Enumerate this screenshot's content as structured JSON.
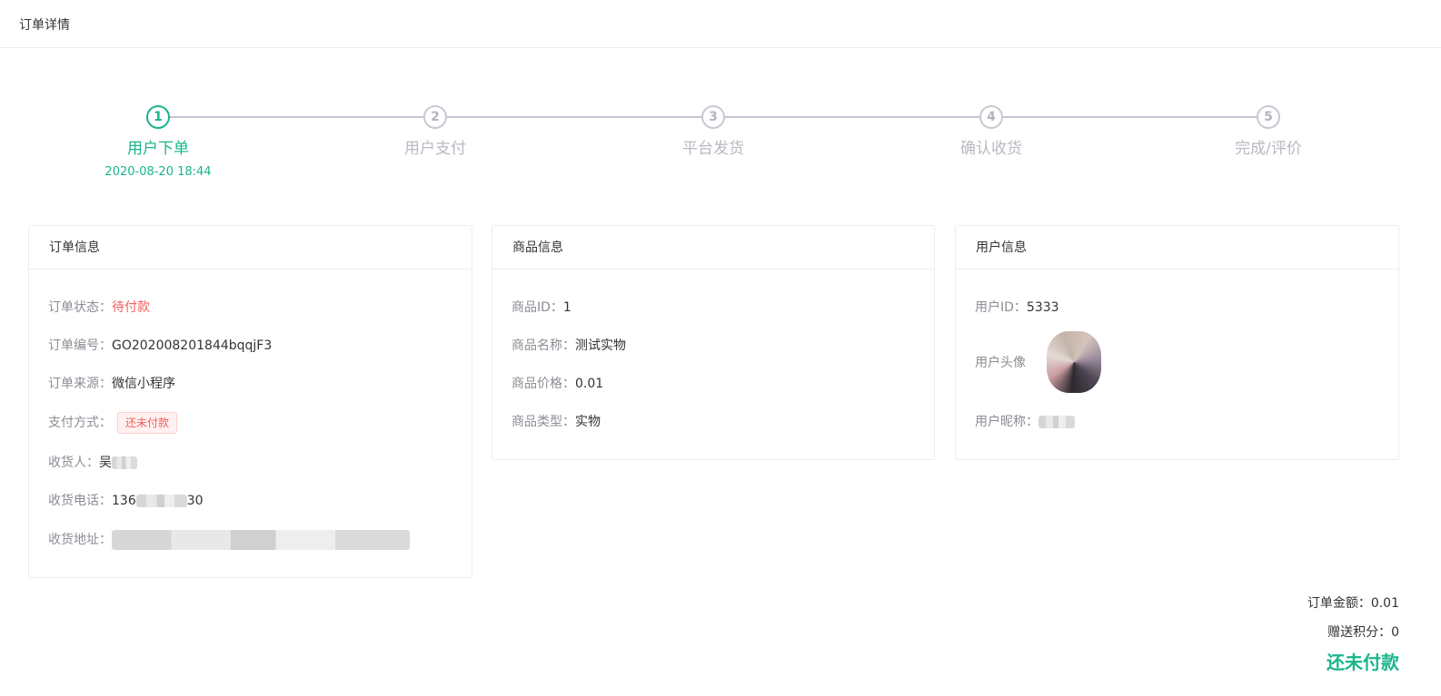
{
  "header": {
    "title": "订单详情"
  },
  "steps": [
    {
      "num": "1",
      "label": "用户下单",
      "time": "2020-08-20 18:44",
      "active": true
    },
    {
      "num": "2",
      "label": "用户支付",
      "time": "",
      "active": false
    },
    {
      "num": "3",
      "label": "平台发货",
      "time": "",
      "active": false
    },
    {
      "num": "4",
      "label": "确认收货",
      "time": "",
      "active": false
    },
    {
      "num": "5",
      "label": "完成/评价",
      "time": "",
      "active": false
    }
  ],
  "order_card": {
    "title": "订单信息",
    "status_label": "订单状态：",
    "status_value": "待付款",
    "no_label": "订单编号：",
    "no_value": "GO202008201844bqqjF3",
    "source_label": "订单来源：",
    "source_value": "微信小程序",
    "pay_label": "支付方式：",
    "pay_value": "还未付款",
    "receiver_label": "收货人：",
    "receiver_value": "吴",
    "phone_label": "收货电话：",
    "phone_prefix": "136",
    "phone_suffix": "30",
    "address_label": "收货地址："
  },
  "goods_card": {
    "title": "商品信息",
    "id_label": "商品ID：",
    "id_value": "1",
    "name_label": "商品名称：",
    "name_value": "测试实物",
    "price_label": "商品价格：",
    "price_value": "0.01",
    "type_label": "商品类型：",
    "type_value": "实物"
  },
  "user_card": {
    "title": "用户信息",
    "id_label": "用户ID：",
    "id_value": "5333",
    "avatar_label": "用户头像",
    "nick_label": "用户昵称："
  },
  "summary": {
    "amount_label": "订单金额：",
    "amount_value": "0.01",
    "points_label": "赠送积分：",
    "points_value": "0",
    "status": "还未付款"
  },
  "colors": {
    "accent": "#19b58b",
    "danger": "#f0605d"
  }
}
